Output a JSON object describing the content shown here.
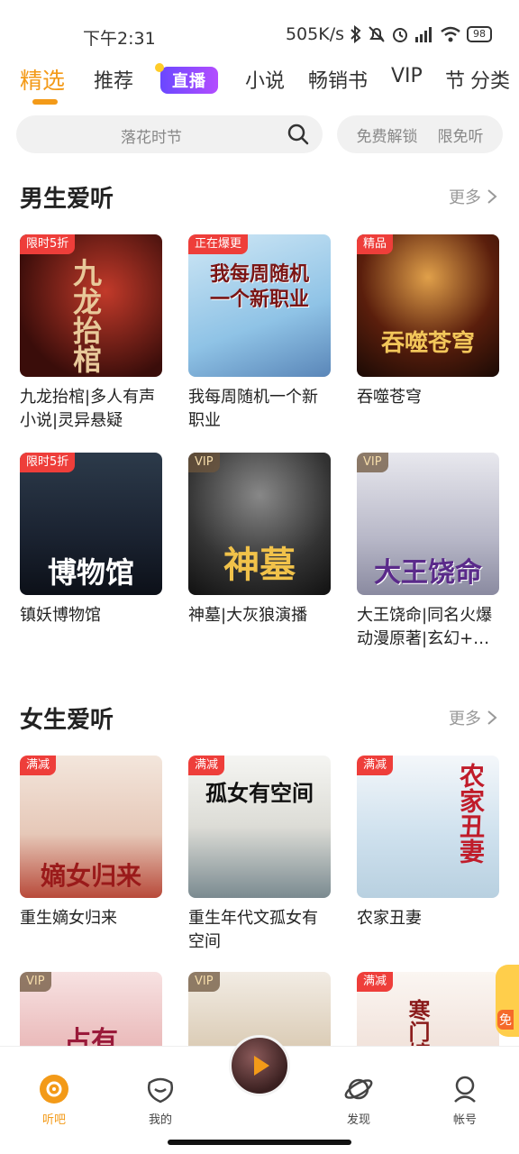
{
  "status_bar": {
    "time": "下午2:31",
    "speed": "505K/s",
    "battery": "98"
  },
  "tabs": [
    {
      "label": "精选"
    },
    {
      "label": "推荐"
    },
    {
      "label": "直播"
    },
    {
      "label": "小说"
    },
    {
      "label": "畅销书"
    },
    {
      "label": "VIP"
    },
    {
      "label": "节"
    },
    {
      "label": "分类"
    }
  ],
  "search": {
    "placeholder": "落花时节"
  },
  "quick_links": [
    "免费解锁",
    "限免听"
  ],
  "sections": [
    {
      "title": "男生爱听",
      "more": "更多",
      "books": [
        {
          "title": "九龙抬棺|多人有声小说|灵异悬疑",
          "tag": "限时5折",
          "cover_text": "九龙抬棺"
        },
        {
          "title": "我每周随机一个新职业",
          "tag": "正在爆更",
          "cover_text": "我每周随机一个新职业"
        },
        {
          "title": "吞噬苍穹",
          "tag": "精品",
          "cover_text": "吞噬苍穹"
        },
        {
          "title": "镇妖博物馆",
          "tag": "限时5折",
          "cover_text": "博物馆"
        },
        {
          "title": "神墓|大灰狼演播",
          "tag": "VIP",
          "cover_text": "神墓"
        },
        {
          "title": "大王饶命|同名火爆动漫原著|玄幻+…",
          "tag": "VIP",
          "cover_text": "大王饶命"
        }
      ]
    },
    {
      "title": "女生爱听",
      "more": "更多",
      "books": [
        {
          "title": "重生嫡女归来",
          "tag": "满减",
          "cover_text": "嫡女归来"
        },
        {
          "title": "重生年代文孤女有空间",
          "tag": "满减",
          "cover_text": "孤女有空间"
        },
        {
          "title": "农家丑妻",
          "tag": "满减",
          "cover_text": "农家丑妻"
        },
        {
          "title": "",
          "tag": "VIP",
          "cover_text": "占有"
        },
        {
          "title": "",
          "tag": "VIP",
          "cover_text": ""
        },
        {
          "title": "",
          "tag": "满减",
          "cover_text": "寒门嫡女"
        }
      ]
    }
  ],
  "float_badge": "免",
  "bottom_nav": [
    {
      "label": "听吧"
    },
    {
      "label": "我的"
    },
    {
      "label": "发现"
    },
    {
      "label": "帐号"
    }
  ],
  "colors": {
    "accent": "#f39a18",
    "tag_red": "#ee3e3a",
    "live": "#7b4dff"
  }
}
